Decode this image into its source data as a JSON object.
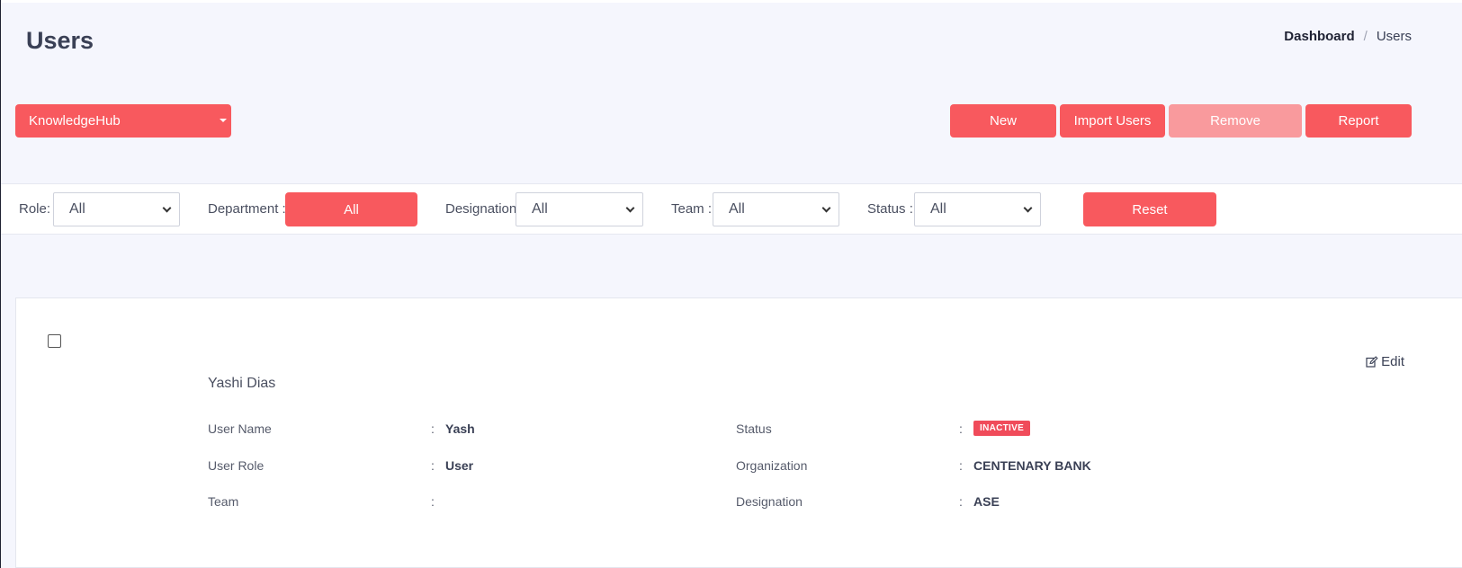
{
  "page": {
    "title": "Users"
  },
  "breadcrumb": {
    "root": "Dashboard",
    "separator": "/",
    "current": "Users"
  },
  "org_selector": {
    "value": "KnowledgeHub"
  },
  "actions": {
    "new": "New",
    "import": "Import Users",
    "remove": "Remove",
    "report": "Report"
  },
  "filters": {
    "role": {
      "label": "Role:",
      "value": "All"
    },
    "department": {
      "label": "Department :",
      "value": "All"
    },
    "designation": {
      "label": "Designation",
      "value": "All"
    },
    "team": {
      "label": "Team :",
      "value": "All"
    },
    "status": {
      "label": "Status :",
      "value": "All"
    },
    "reset": "Reset"
  },
  "user_card": {
    "edit": "Edit",
    "name": "Yashi Dias",
    "separator": ":",
    "fields": {
      "username": {
        "label": "User Name",
        "value": "Yash"
      },
      "role": {
        "label": "User Role",
        "value": "User"
      },
      "team": {
        "label": "Team",
        "value": ""
      },
      "status": {
        "label": "Status",
        "value": "INACTIVE"
      },
      "organization": {
        "label": "Organization",
        "value": "CENTENARY BANK"
      },
      "designation": {
        "label": "Designation",
        "value": "ASE"
      }
    }
  },
  "colors": {
    "accent": "#f8595e",
    "accent_disabled": "#f99a9d",
    "badge_inactive": "#f04b5a",
    "background": "#f5f6fd"
  },
  "icons": {
    "edit": "edit-icon",
    "dropdown": "chevron-down-icon",
    "caret": "caret-down-icon"
  }
}
